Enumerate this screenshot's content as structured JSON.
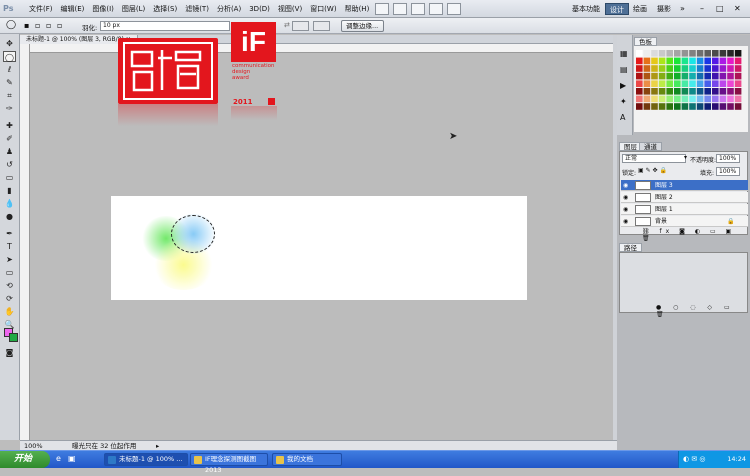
{
  "menubar": {
    "app_icon": "Ps",
    "items": [
      "文件(F)",
      "编辑(E)",
      "图像(I)",
      "图层(L)",
      "选择(S)",
      "滤镜(T)",
      "分析(A)",
      "3D(D)",
      "视图(V)",
      "窗口(W)",
      "帮助(H)"
    ],
    "workspaces": [
      "基本功能",
      "设计",
      "绘画",
      "摄影"
    ],
    "active_workspace": "设计"
  },
  "options": {
    "feather_label": "羽化:",
    "feather_value": "10 px",
    "refine_label": "调整边缘..."
  },
  "document": {
    "tab_title": "未标题-1 @ 100% (图层 3, RGB/8)"
  },
  "logos": {
    "if_text": "iF",
    "lines": [
      "communication",
      "design",
      "award"
    ],
    "year": "2011"
  },
  "status": {
    "zoom": "100%",
    "info": "曝光只在 32 位起作用"
  },
  "panels": {
    "swatch_tab": "色板",
    "layers_tab": "图层",
    "channels_tab": "通道",
    "blend_mode": "正常",
    "opacity_label": "不透明度:",
    "opacity_value": "100%",
    "lock_label": "锁定:",
    "fill_label": "填充:",
    "fill_value": "100%",
    "layers": [
      {
        "name": "图层 3",
        "selected": true
      },
      {
        "name": "图层 2",
        "selected": false
      },
      {
        "name": "图层 1",
        "selected": false
      },
      {
        "name": "背景",
        "selected": false
      }
    ],
    "paths_tab": "路径"
  },
  "taskbar": {
    "start": "开始",
    "tasks": [
      "未标题-1 @ 100% ...",
      "IF理念探测图截图2013",
      "我的文档"
    ],
    "time": "14:24"
  },
  "colors": {
    "foreground": "#ee66ee",
    "background": "#22aa44",
    "red_brand": "#e3161d"
  }
}
